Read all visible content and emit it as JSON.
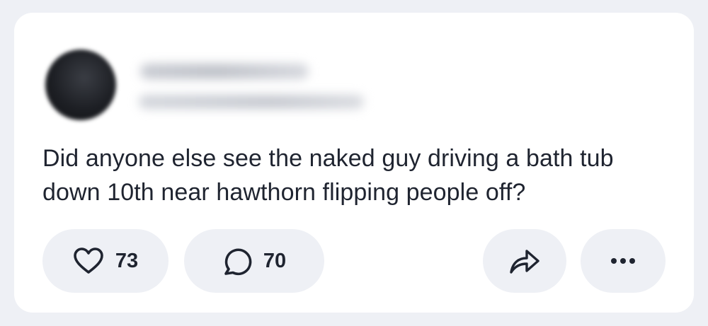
{
  "post": {
    "text": "Did anyone else see the naked guy driving a bath tub down 10th near hawthorn flipping people off?"
  },
  "actions": {
    "likes_count": "73",
    "comments_count": "70",
    "like_icon": "heart-icon",
    "comment_icon": "speech-bubble-icon",
    "share_icon": "share-arrow-icon",
    "more_icon": "ellipsis-icon"
  },
  "colors": {
    "page_background": "#eef0f5",
    "card_background": "#ffffff",
    "text": "#1f2430",
    "pill_background": "#eef0f5"
  }
}
